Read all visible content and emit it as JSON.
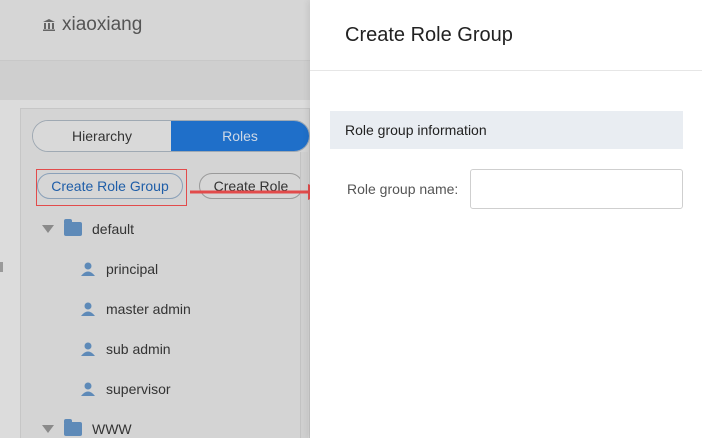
{
  "header": {
    "title": "xiaoxiang",
    "icon": "bank-icon"
  },
  "tabs": {
    "left_label": "Hierarchy",
    "right_label": "Roles",
    "active": "Roles"
  },
  "buttons": {
    "create_role_group": "Create Role Group",
    "create_role": "Create Role"
  },
  "tree": {
    "groups": [
      {
        "label": "default",
        "icon": "folder-icon",
        "children": [
          {
            "label": "principal",
            "icon": "user-icon"
          },
          {
            "label": "master admin",
            "icon": "user-icon"
          },
          {
            "label": "sub admin",
            "icon": "user-icon"
          },
          {
            "label": "supervisor",
            "icon": "user-icon"
          }
        ]
      },
      {
        "label": "WWW",
        "icon": "folder-icon",
        "children": []
      }
    ]
  },
  "drawer": {
    "title": "Create Role Group",
    "section_title": "Role group information",
    "field_label": "Role group name:",
    "field_value": "",
    "field_placeholder": ""
  },
  "colors": {
    "accent": "#1f6fc9",
    "annotation": "#e24b4b"
  }
}
